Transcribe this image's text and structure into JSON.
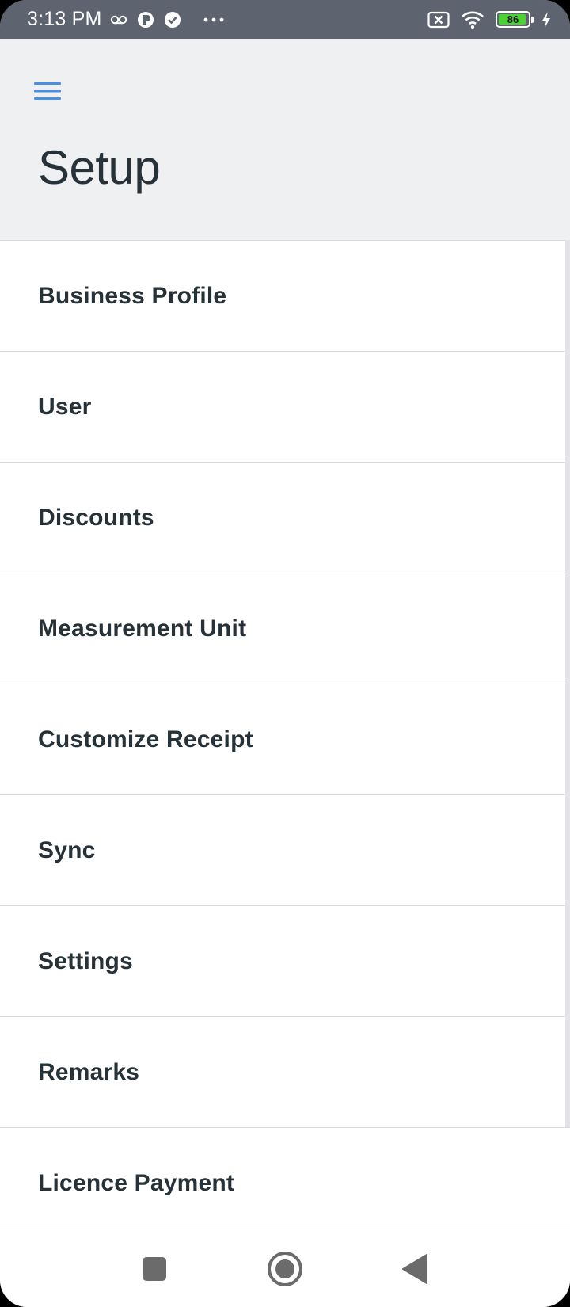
{
  "status_bar": {
    "time": "3:13 PM",
    "battery_level": "86",
    "icons": [
      "voicemail-icon",
      "p-app-icon",
      "check-circle-icon",
      "more-dots-icon",
      "no-sim-icon",
      "wifi-icon",
      "battery-icon",
      "charging-bolt-icon"
    ]
  },
  "header": {
    "title": "Setup",
    "menu_icon": "hamburger-menu-icon"
  },
  "menu": {
    "items": [
      {
        "label": "Business Profile"
      },
      {
        "label": "User"
      },
      {
        "label": "Discounts"
      },
      {
        "label": "Measurement Unit"
      },
      {
        "label": "Customize Receipt"
      },
      {
        "label": "Sync"
      },
      {
        "label": "Settings"
      },
      {
        "label": "Remarks"
      },
      {
        "label": "Licence Payment"
      }
    ]
  },
  "nav_bar": {
    "buttons": [
      "recents-square-icon",
      "home-circle-icon",
      "back-triangle-icon"
    ]
  },
  "colors": {
    "header_bg": "#eff0f2",
    "status_bar_bg": "#5d6470",
    "accent": "#4a90e2",
    "text": "#263238",
    "battery_fill": "#4cd137"
  }
}
